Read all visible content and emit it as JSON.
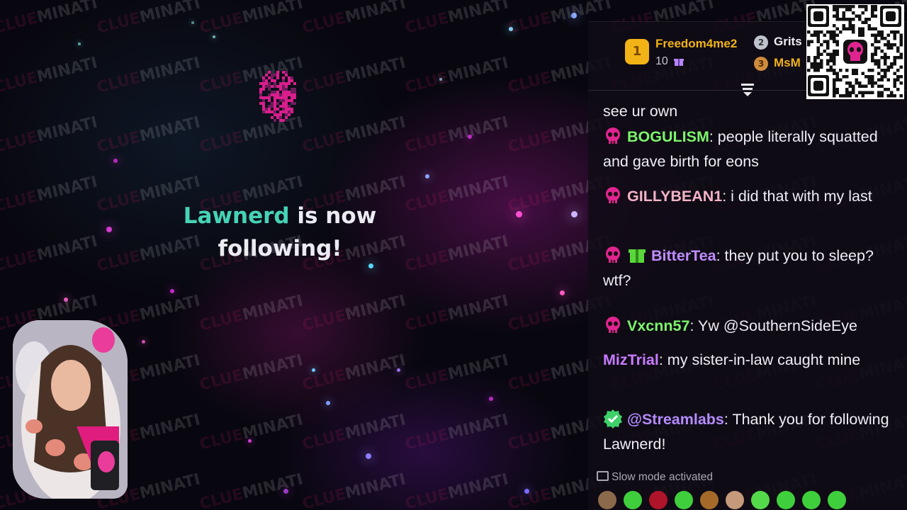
{
  "alert": {
    "follower_name": "Lawnerd",
    "line1_rest": " is now",
    "line2": "following!"
  },
  "watermark": {
    "part1": "CLUE",
    "part2": "MINATI"
  },
  "leaderboard": {
    "first": {
      "rank": "1",
      "name": "Freedom4me2",
      "count": "10",
      "icon": "gift-icon"
    },
    "second": {
      "rank": "2",
      "name": "Grits"
    },
    "third": {
      "rank": "3",
      "name": "MsM"
    }
  },
  "chat": {
    "partial_top": "see ur own",
    "messages": [
      {
        "user": "BOGULISM",
        "user_color": "#7cf56b",
        "badges": [
          "skull-badge-icon"
        ],
        "text": "people literally squatted and gave birth for eons"
      },
      {
        "user": "GILLYBEAN1",
        "user_color": "#f2b3c5",
        "badges": [
          "skull-badge-icon"
        ],
        "text": "i did that with my last"
      },
      {
        "user": "BitterTea",
        "user_color": "#c08cff",
        "badges": [
          "skull-badge-icon",
          "gift-sub-icon"
        ],
        "text": "they put you to sleep? wtf?"
      },
      {
        "user": "Vxcnn57",
        "user_color": "#7cf56b",
        "badges": [
          "skull-badge-icon"
        ],
        "text": "Yw @SouthernSideEye"
      },
      {
        "user": "MizTrial",
        "user_color": "#c77bff",
        "badges": [],
        "text": "my sister-in-law caught mine"
      },
      {
        "user": "@Streamlabs",
        "user_color": "#b48bff",
        "badges": [
          "verified-icon"
        ],
        "text": "Thank you for following Lawnerd!"
      }
    ],
    "slow_mode": "Slow mode activated",
    "emotes": [
      "cat-emote",
      "frog-emote",
      "red-emote",
      "frog-emote",
      "box-emote",
      "figure-emote",
      "frog-halo-emote",
      "frog-emote",
      "frog-emote",
      "frog-emote"
    ]
  },
  "colors": {
    "accent_pink": "#e0246e",
    "follower_teal": "#46d3b6",
    "gold": "#f2b316"
  }
}
